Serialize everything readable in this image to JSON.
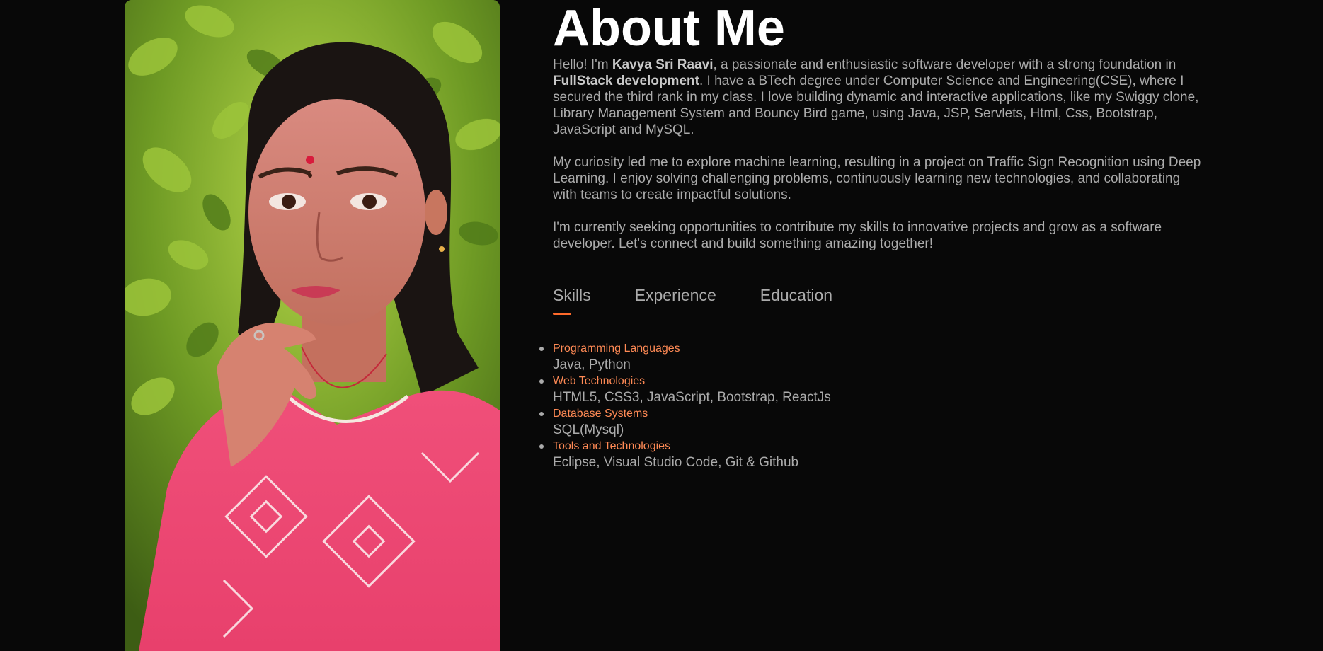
{
  "about": {
    "title": "About Me",
    "bio": {
      "p1_intro": "Hello! I'm ",
      "p1_name": "Kavya Sri Raavi",
      "p1_mid": ", a passionate and enthusiastic software developer with a strong foundation in ",
      "p1_focus": "FullStack development",
      "p1_rest": ". I have a BTech degree under Computer Science and Engineering(CSE), where I secured the third rank in my class. I love building dynamic and interactive applications, like my Swiggy clone, Library Management System and Bouncy Bird game, using Java, JSP, Servlets, Html, Css, Bootstrap, JavaScript and MySQL.",
      "p2": "My curiosity led me to explore machine learning, resulting in a project on Traffic Sign Recognition using Deep Learning. I enjoy solving challenging problems, continuously learning new technologies, and collaborating with teams to create impactful solutions.",
      "p3": "I'm currently seeking opportunities to contribute my skills to innovative projects and grow as a software developer. Let's connect and build something amazing together!"
    }
  },
  "tabs": [
    {
      "label": "Skills",
      "active": true
    },
    {
      "label": "Experience",
      "active": false
    },
    {
      "label": "Education",
      "active": false
    }
  ],
  "skills": [
    {
      "category": "Programming Languages",
      "value": "Java, Python"
    },
    {
      "category": "Web Technologies",
      "value": "HTML5, CSS3, JavaScript, Bootstrap, ReactJs"
    },
    {
      "category": "Database Systems",
      "value": "SQL(Mysql)"
    },
    {
      "category": "Tools and Technologies",
      "value": "Eclipse, Visual Studio Code, Git & Github"
    }
  ],
  "colors": {
    "background": "#080808",
    "accent": "#ff6a2b",
    "skill_category": "#ff8a55",
    "body_text": "#ababab",
    "heading": "#ffffff"
  }
}
